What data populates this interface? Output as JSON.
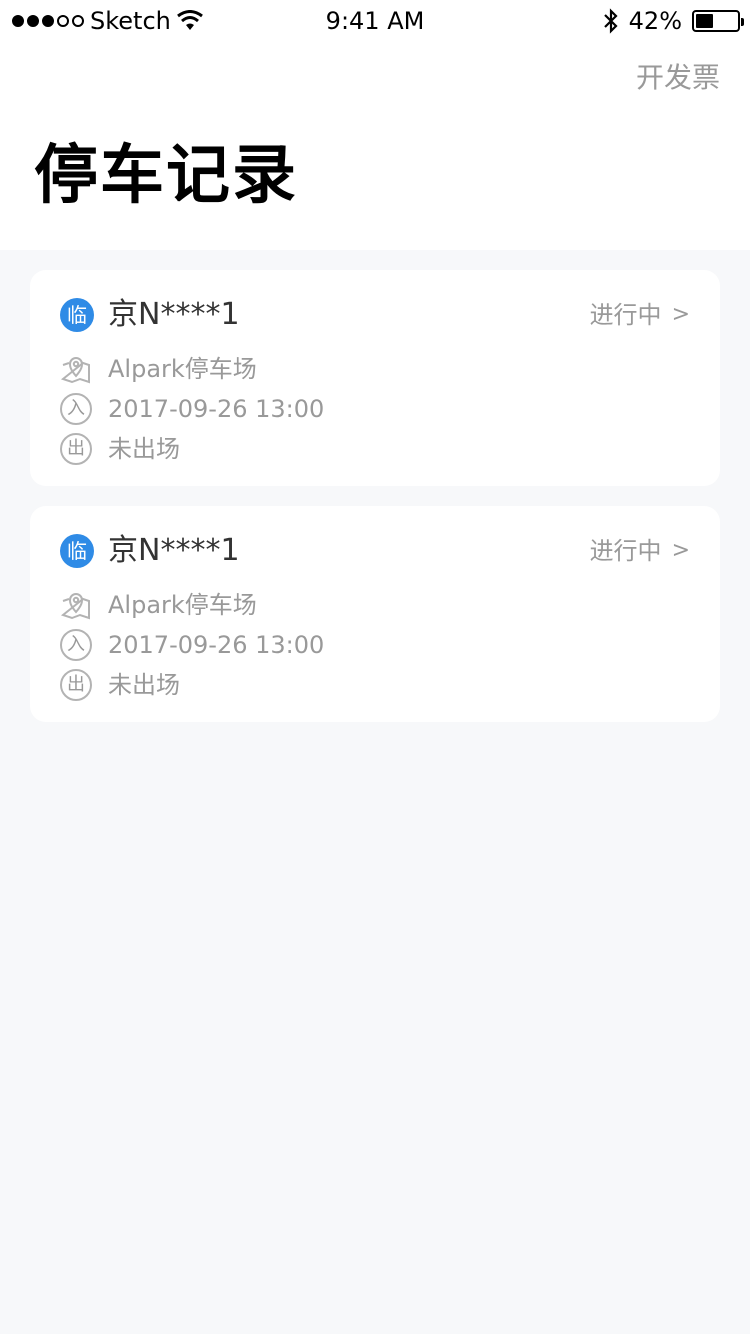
{
  "status_bar": {
    "carrier": "Sketch",
    "time": "9:41 AM",
    "battery": "42%",
    "battery_level": 0.42
  },
  "nav": {
    "action_label": "开发票"
  },
  "page": {
    "title": "停车记录"
  },
  "records": [
    {
      "badge": "临",
      "plate": "京N****1",
      "status": "进行中",
      "status_chevron": ">",
      "lot": "Alpark停车场",
      "entry_icon_text": "入",
      "entry_time": "2017-09-26 13:00",
      "exit_icon_text": "出",
      "exit_status": "未出场"
    },
    {
      "badge": "临",
      "plate": "京N****1",
      "status": "进行中",
      "status_chevron": ">",
      "lot": "Alpark停车场",
      "entry_icon_text": "入",
      "entry_time": "2017-09-26 13:00",
      "exit_icon_text": "出",
      "exit_status": "未出场"
    }
  ],
  "colors": {
    "accent": "#2f8be6",
    "background": "#f7f8fa",
    "muted_text": "#999999",
    "primary_text": "#333333"
  }
}
